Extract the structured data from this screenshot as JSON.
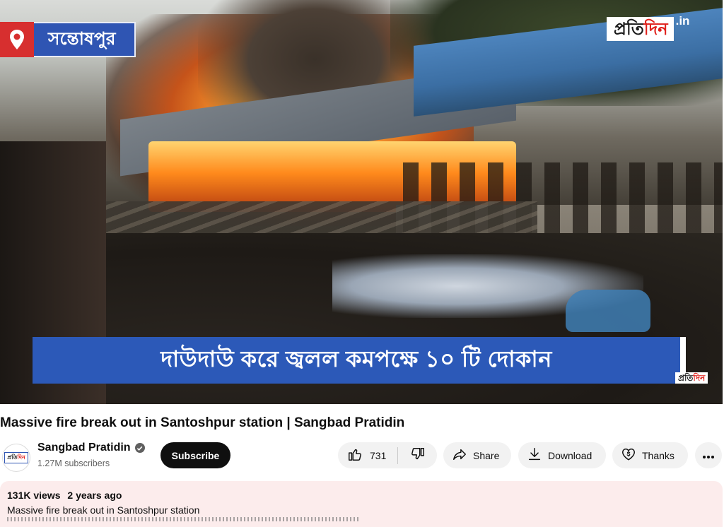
{
  "video": {
    "location_label": "সন্তোষপুর",
    "brand_name_part1": "প্রতি",
    "brand_name_part2": "দিন",
    "brand_suffix": ".in",
    "caption": "দাউদাউ করে জ্বলল কমপক্ষে ১০ টি দোকান",
    "mini_brand_part1": "প্রতি",
    "mini_brand_part2": "দিন"
  },
  "title": "Massive fire break out in Santoshpur station | Sangbad Pratidin",
  "channel": {
    "name": "Sangbad Pratidin",
    "subscribers": "1.27M subscribers",
    "avatar_part1": "প্রতি",
    "avatar_part2": "দিন",
    "verified_icon": "check-circle-icon"
  },
  "actions": {
    "subscribe_label": "Subscribe",
    "like_count": "731",
    "share_label": "Share",
    "download_label": "Download",
    "thanks_label": "Thanks",
    "more_icon": "ellipsis-icon"
  },
  "description": {
    "views": "131K views",
    "age": "2 years ago",
    "text": "Massive fire break out in Santoshpur station"
  },
  "colors": {
    "badge_red": "#d72f2f",
    "banner_blue": "#2c59b8",
    "subscribe_bg": "#0f0f0f",
    "pill_bg": "#f2f2f2",
    "description_bg": "#fcecec"
  }
}
